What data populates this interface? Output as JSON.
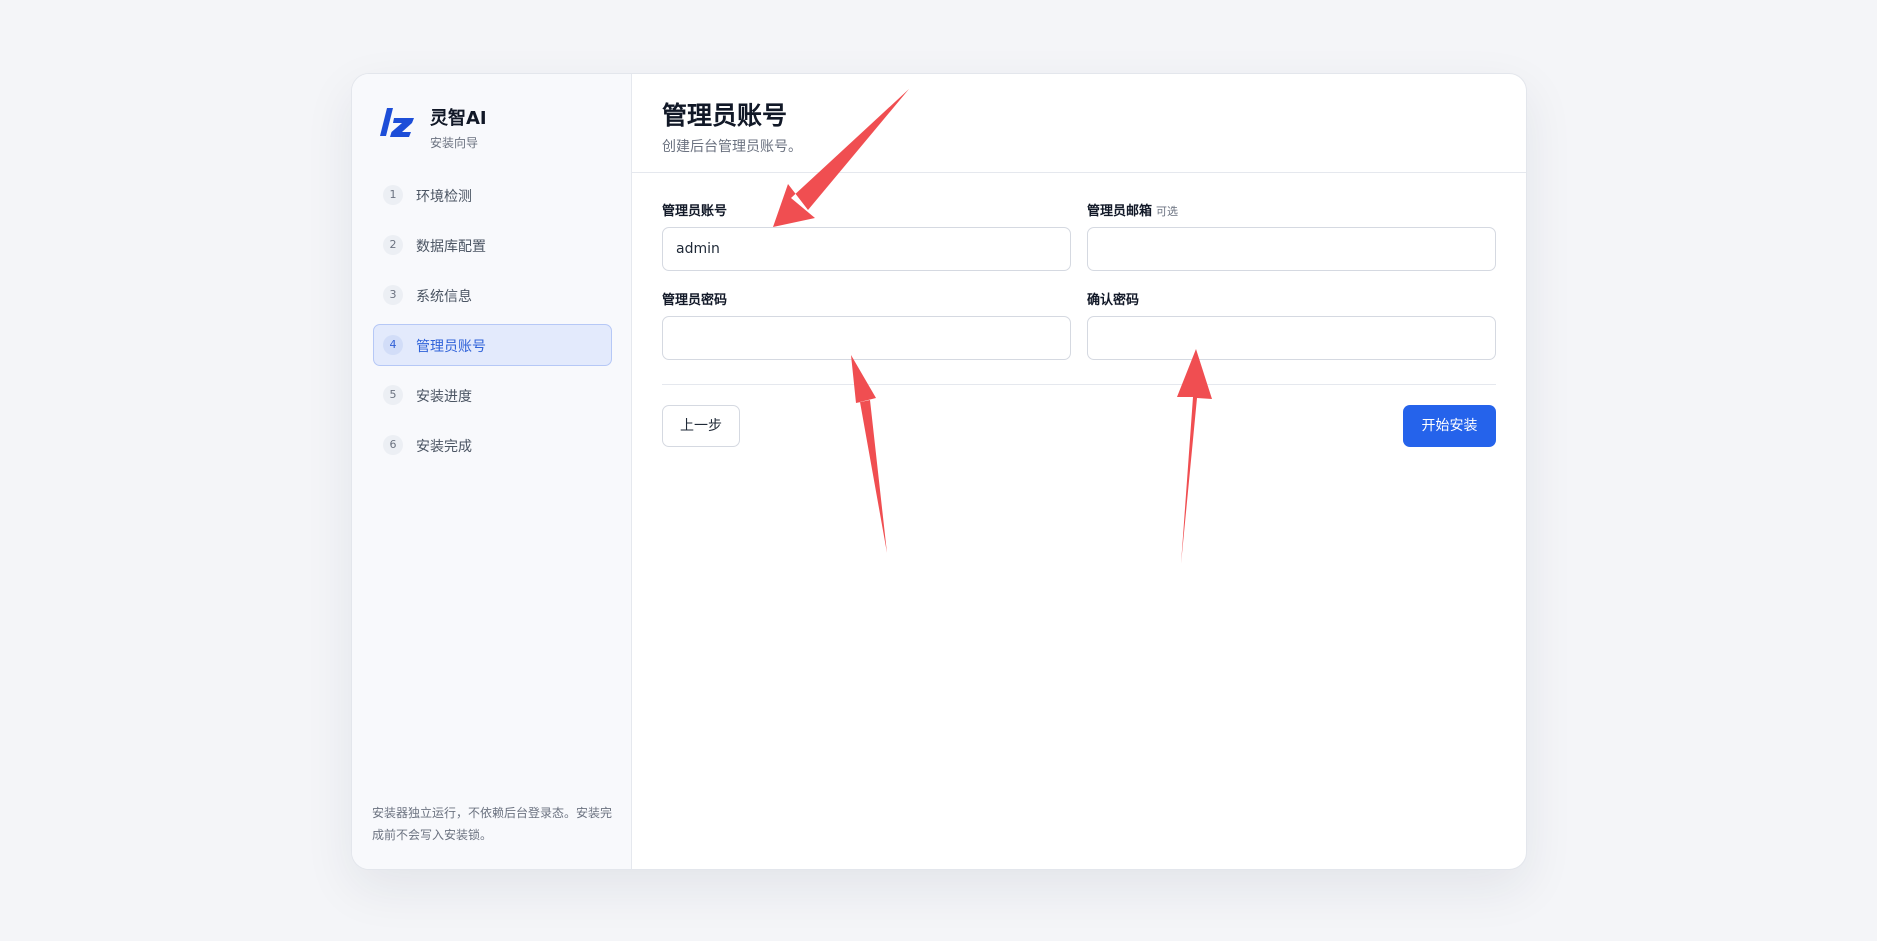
{
  "brand": {
    "name": "灵智AI",
    "subtitle": "安装向导",
    "logo_icon": "lz-logo",
    "logo_color": "#1d4ed8"
  },
  "steps": [
    {
      "number": "1",
      "label": "环境检测"
    },
    {
      "number": "2",
      "label": "数据库配置"
    },
    {
      "number": "3",
      "label": "系统信息"
    },
    {
      "number": "4",
      "label": "管理员账号",
      "active": true
    },
    {
      "number": "5",
      "label": "安装进度"
    },
    {
      "number": "6",
      "label": "安装完成"
    }
  ],
  "sidebar_note": "安装器独立运行，不依赖后台登录态。安装完成前不会写入安装锁。",
  "header": {
    "title": "管理员账号",
    "subtitle": "创建后台管理员账号。"
  },
  "form": {
    "username": {
      "label": "管理员账号",
      "value": "admin"
    },
    "email": {
      "label": "管理员邮箱",
      "optional": "可选",
      "value": ""
    },
    "password": {
      "label": "管理员密码",
      "value": ""
    },
    "confirm": {
      "label": "确认密码",
      "value": ""
    }
  },
  "buttons": {
    "prev": "上一步",
    "install": "开始安装"
  },
  "colors": {
    "accent": "#2563eb",
    "active_step_bg": "#e3eafc",
    "annotation_arrow": "#f04e51"
  }
}
